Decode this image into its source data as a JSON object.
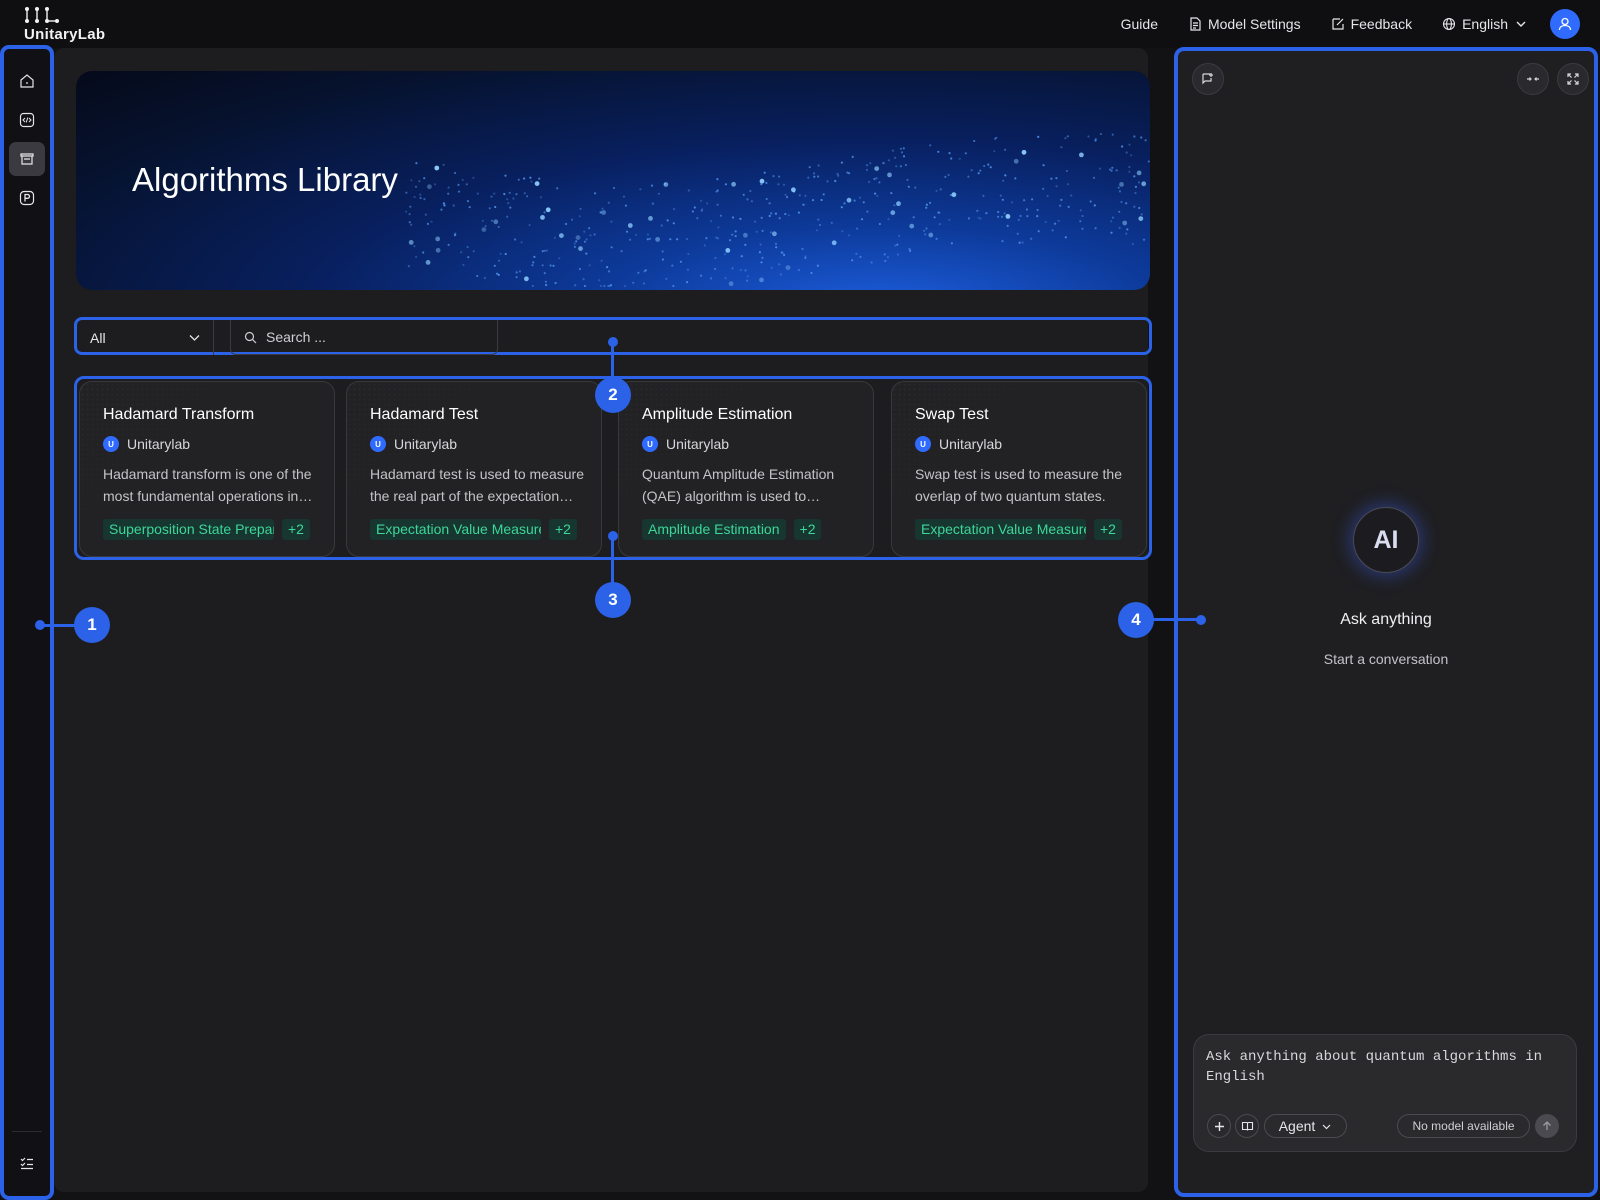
{
  "app": {
    "brand": "UnitaryLab"
  },
  "topnav": {
    "guide": "Guide",
    "model_settings": "Model Settings",
    "feedback": "Feedback",
    "language": "English"
  },
  "sidebar": {
    "items": [
      {
        "icon": "home-icon"
      },
      {
        "icon": "code-icon"
      },
      {
        "icon": "library-icon",
        "active": true
      },
      {
        "icon": "p-badge-icon"
      }
    ],
    "bottom_icon": "task-list-icon"
  },
  "banner": {
    "title": "Algorithms Library"
  },
  "filter": {
    "selected": "All",
    "search_placeholder": "Search ..."
  },
  "cards": [
    {
      "title": "Hadamard Transform",
      "org": "Unitarylab",
      "desc": "Hadamard transform is one of the most fundamental operations in quantum computing.",
      "tag": "Superposition State Preparation",
      "more": "+2"
    },
    {
      "title": "Hadamard Test",
      "org": "Unitarylab",
      "desc": "Hadamard test is used to measure the real part of the expectation value.",
      "tag": "Expectation Value Measurement",
      "more": "+2"
    },
    {
      "title": "Amplitude Estimation",
      "org": "Unitarylab",
      "desc": "Quantum Amplitude Estimation (QAE) algorithm is used to estimate amplitudes.",
      "tag": "Amplitude Estimation",
      "more": "+2"
    },
    {
      "title": "Swap Test",
      "org": "Unitarylab",
      "desc": "Swap test is used to measure the overlap of two quantum states.",
      "tag": "Expectation Value Measurement",
      "more": "+2"
    }
  ],
  "chat": {
    "badge": "AI",
    "title": "Ask anything",
    "subtitle": "Start a conversation",
    "input_placeholder": "Ask anything about quantum algorithms in English",
    "mode": "Agent",
    "model_status": "No model available"
  },
  "markers": [
    "1",
    "2",
    "3",
    "4"
  ],
  "colors": {
    "accent": "#2b62e8",
    "tag_text": "#3ed69a",
    "tag_bg": "#16362f"
  }
}
